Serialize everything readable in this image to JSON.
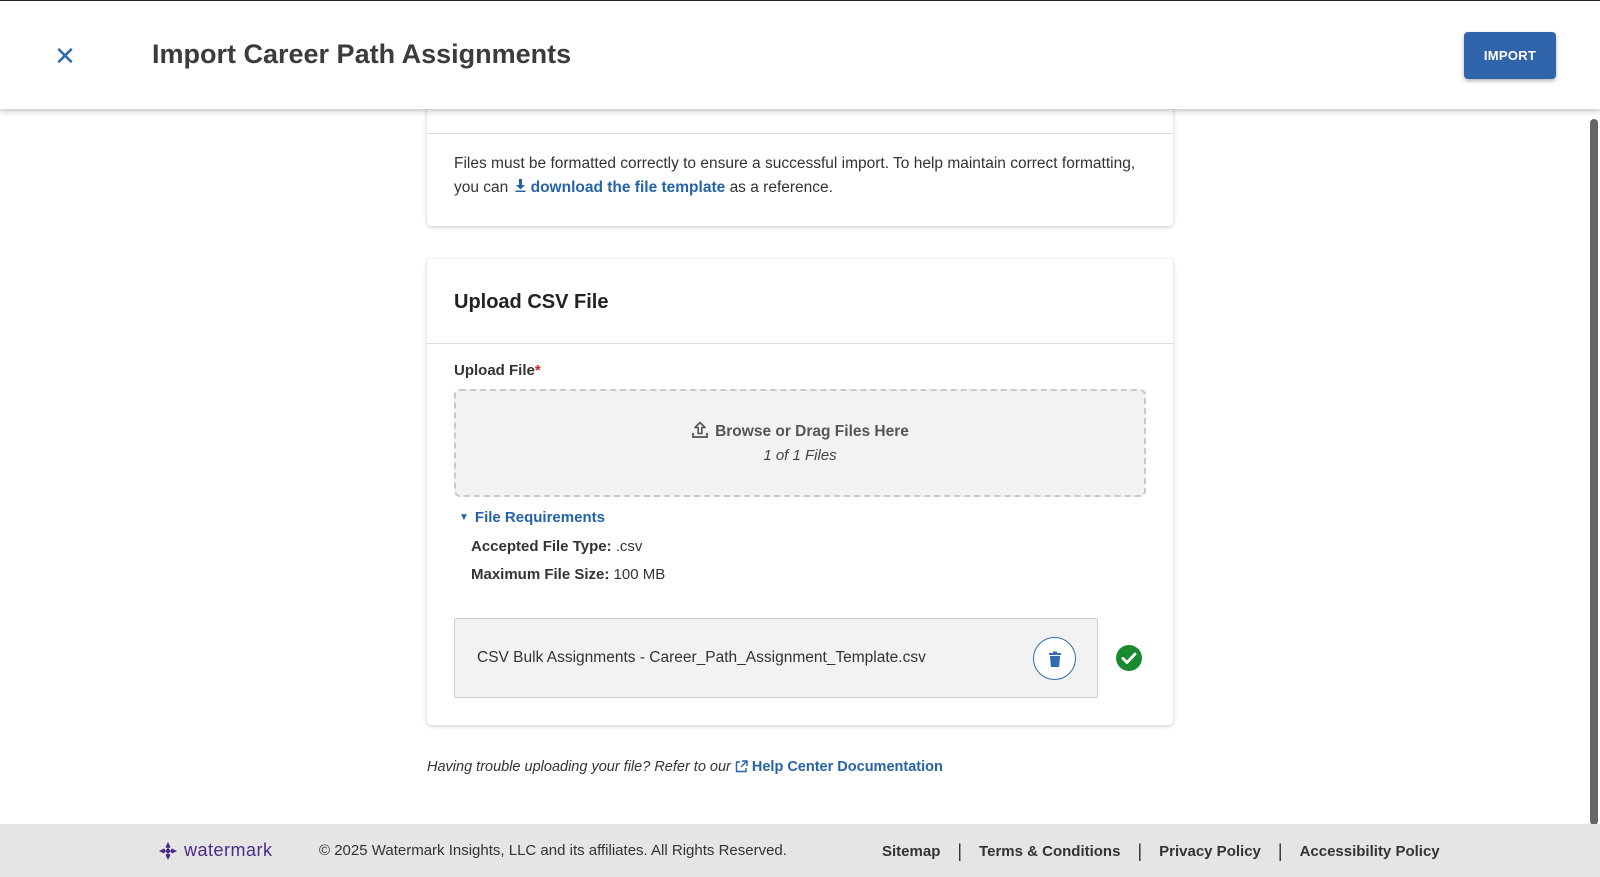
{
  "header": {
    "close_icon": "close-icon",
    "title": "Import Career Path Assignments",
    "import_label": "IMPORT"
  },
  "info_card": {
    "text_before": "Files must be formatted correctly to ensure a successful import. To help maintain correct formatting, you can",
    "download_icon": "download-icon",
    "download_link": "download the file template",
    "text_after": "as a reference."
  },
  "upload_card": {
    "title": "Upload CSV File",
    "field_label": "Upload File",
    "required_mark": "*",
    "dropzone": {
      "main": "Browse or Drag Files Here",
      "sub": "1 of 1 Files"
    },
    "requirements": {
      "toggle_label": "File Requirements",
      "type_label": "Accepted File Type:",
      "type_value": ".csv",
      "size_label": "Maximum File Size:",
      "size_value": "100 MB"
    },
    "file": {
      "name": "CSV Bulk Assignments - Career_Path_Assignment_Template.csv",
      "status": "success",
      "status_color": "#1a8a2e"
    }
  },
  "help": {
    "text": "Having trouble uploading your file? Refer to our",
    "link": "Help Center Documentation"
  },
  "footer": {
    "logo_text": "watermark",
    "copyright": "© 2025 Watermark Insights, LLC and its affiliates. All Rights Reserved.",
    "links": [
      "Sitemap",
      "Terms & Conditions",
      "Privacy Policy",
      "Accessibility Policy"
    ]
  },
  "colors": {
    "primary": "#3064aa",
    "link": "#2563a8",
    "required": "#c62828",
    "brand": "#4b2a8a"
  }
}
